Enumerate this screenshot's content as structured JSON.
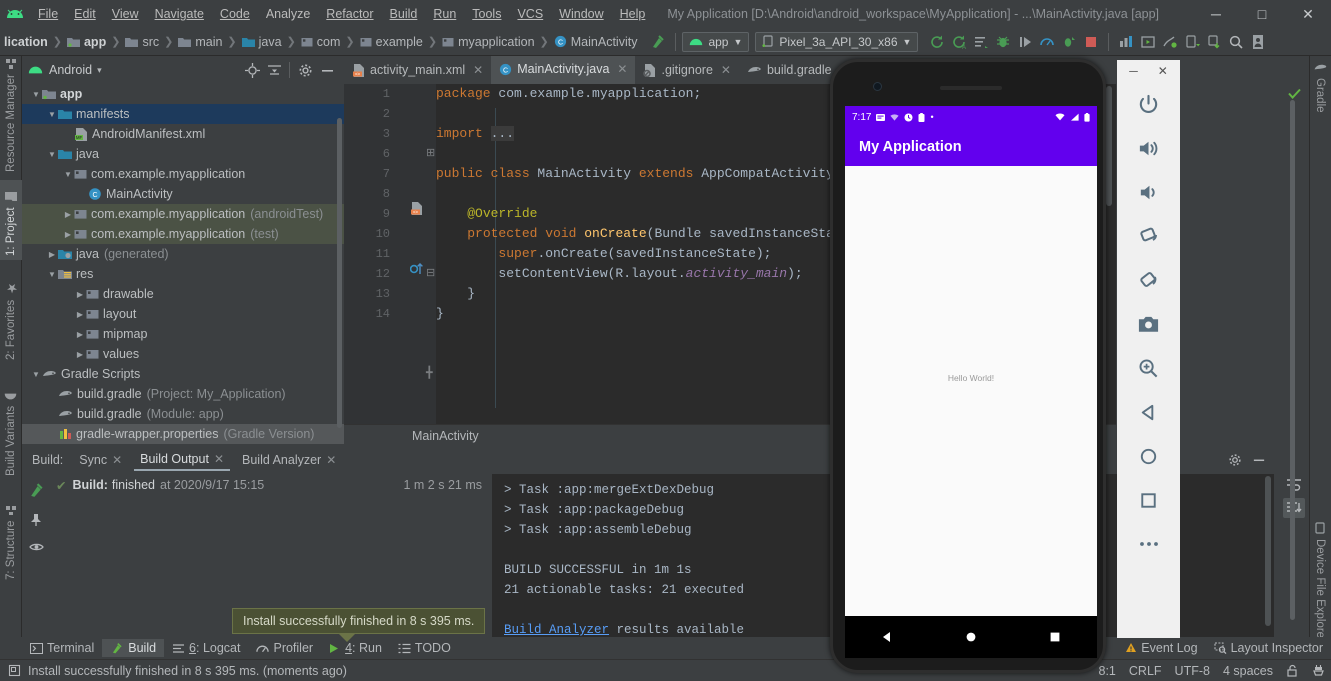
{
  "window": {
    "title": "My Application [D:\\Android\\android_workspace\\MyApplication] - ...\\MainActivity.java [app]",
    "minimize": "─",
    "maximize": "□",
    "close": "✕"
  },
  "menubar": {
    "items": [
      {
        "label": "File"
      },
      {
        "label": "Edit"
      },
      {
        "label": "View"
      },
      {
        "label": "Navigate"
      },
      {
        "label": "Code"
      },
      {
        "label": "Analyze"
      },
      {
        "label": "Refactor"
      },
      {
        "label": "Build"
      },
      {
        "label": "Run"
      },
      {
        "label": "Tools"
      },
      {
        "label": "VCS"
      },
      {
        "label": "Window"
      },
      {
        "label": "Help"
      }
    ]
  },
  "toolbar": {
    "breadcrumb": [
      {
        "label": "lication",
        "icon": "project-icon"
      },
      {
        "label": "app",
        "icon": "module-icon"
      },
      {
        "label": "src",
        "icon": "folder-icon"
      },
      {
        "label": "main",
        "icon": "folder-icon"
      },
      {
        "label": "java",
        "icon": "source-folder-icon"
      },
      {
        "label": "com",
        "icon": "package-icon"
      },
      {
        "label": "example",
        "icon": "package-icon"
      },
      {
        "label": "myapplication",
        "icon": "package-icon"
      },
      {
        "label": "MainActivity",
        "icon": "class-icon"
      }
    ],
    "run_config": "app",
    "device": "Pixel_3a_API_30_x86",
    "icons": [
      "sync-project-icon",
      "avd-manager-icon",
      "layout-inspector-icon",
      "debug-icon",
      "run-step-icon",
      "profiler-icon",
      "run-attach-icon",
      "stop-icon",
      "sdk-manager-icon",
      "avd-icon",
      "device-manager-icon",
      "device-monitor-icon",
      "sync-gradle-icon",
      "search-icon",
      "user-icon"
    ]
  },
  "left_rail": {
    "items": [
      {
        "label": "Resource Manager",
        "selected": false
      },
      {
        "label": "1: Project",
        "selected": true
      },
      {
        "label": "2: Favorites",
        "selected": false
      },
      {
        "label": "Build Variants",
        "selected": false
      },
      {
        "label": "7: Structure",
        "selected": false
      }
    ]
  },
  "right_rail": {
    "items": [
      {
        "label": "Gradle"
      },
      {
        "label": "Device File Explorer"
      }
    ]
  },
  "project_panel": {
    "title": "Android",
    "dropdown": "▾",
    "header_icons": [
      "locate-icon",
      "collapse-all-icon",
      "gear-icon",
      "hide-icon"
    ],
    "tree": [
      {
        "indent": 0,
        "arrow": "▼",
        "icon": "module-icon",
        "label": "app",
        "dim": "",
        "state": "bold"
      },
      {
        "indent": 1,
        "arrow": "▼",
        "icon": "folder-blue-icon",
        "label": "manifests",
        "dim": "",
        "state": "selected"
      },
      {
        "indent": 2,
        "arrow": "",
        "icon": "manifest-file-icon",
        "label": "AndroidManifest.xml",
        "dim": "",
        "state": ""
      },
      {
        "indent": 1,
        "arrow": "▼",
        "icon": "folder-blue-icon",
        "label": "java",
        "dim": "",
        "state": ""
      },
      {
        "indent": 2,
        "arrow": "▼",
        "icon": "package-icon",
        "label": "com.example.myapplication",
        "dim": "",
        "state": ""
      },
      {
        "indent": 3,
        "arrow": "",
        "icon": "class-icon",
        "label": "MainActivity",
        "dim": "",
        "state": ""
      },
      {
        "indent": 2,
        "arrow": "▶",
        "icon": "package-icon",
        "label": "com.example.myapplication",
        "dim": "(androidTest)",
        "state": "testscope"
      },
      {
        "indent": 2,
        "arrow": "▶",
        "icon": "package-icon",
        "label": "com.example.myapplication",
        "dim": "(test)",
        "state": "testscope"
      },
      {
        "indent": 1,
        "arrow": "▶",
        "icon": "generated-folder-icon",
        "label": "java",
        "dim": "(generated)",
        "state": ""
      },
      {
        "indent": 1,
        "arrow": "▼",
        "icon": "res-folder-icon",
        "label": "res",
        "dim": "",
        "state": ""
      },
      {
        "indent": 2,
        "arrow": "▶",
        "icon": "package-icon",
        "label": "drawable",
        "dim": "",
        "state": ""
      },
      {
        "indent": 2,
        "arrow": "▶",
        "icon": "package-icon",
        "label": "layout",
        "dim": "",
        "state": ""
      },
      {
        "indent": 2,
        "arrow": "▶",
        "icon": "package-icon",
        "label": "mipmap",
        "dim": "",
        "state": ""
      },
      {
        "indent": 2,
        "arrow": "▶",
        "icon": "package-icon",
        "label": "values",
        "dim": "",
        "state": ""
      },
      {
        "indent": 0,
        "arrow": "▼",
        "icon": "gradle-icon",
        "label": "Gradle Scripts",
        "dim": "",
        "state": ""
      },
      {
        "indent": 1,
        "arrow": "",
        "icon": "gradle-icon",
        "label": "build.gradle",
        "dim": "(Project: My_Application)",
        "state": ""
      },
      {
        "indent": 1,
        "arrow": "",
        "icon": "gradle-icon",
        "label": "build.gradle",
        "dim": "(Module: app)",
        "state": ""
      },
      {
        "indent": 1,
        "arrow": "",
        "icon": "properties-icon",
        "label": "gradle-wrapper.properties",
        "dim": "(Gradle Version)",
        "state": "gw"
      }
    ]
  },
  "editor": {
    "tabs": [
      {
        "label": "activity_main.xml",
        "icon": "layout-xml-icon",
        "active": false,
        "close": "✕"
      },
      {
        "label": "MainActivity.java",
        "icon": "class-icon",
        "active": true,
        "close": "✕"
      },
      {
        "label": ".gitignore",
        "icon": "gitignore-icon",
        "active": false,
        "close": "✕"
      },
      {
        "label": "build.gradle",
        "icon": "gradle-icon",
        "active": false,
        "close": ""
      }
    ],
    "line_numbers": [
      "1",
      "2",
      "3",
      "6",
      "7",
      "8",
      "9",
      "10",
      "11",
      "12",
      "13",
      "14"
    ],
    "lines": [
      "package com.example.myapplication;",
      "",
      "import ...",
      "",
      "public class MainActivity extends AppCompatActivity {",
      "",
      "    @Override",
      "    protected void onCreate(Bundle savedInstanceState) {",
      "        super.onCreate(savedInstanceState);",
      "        setContentView(R.layout.activity_main);",
      "    }",
      "}"
    ],
    "breadcrumb_bottom": "MainActivity"
  },
  "build_panel": {
    "label": "Build:",
    "tabs": [
      {
        "label": "Sync",
        "active": false,
        "close": "✕"
      },
      {
        "label": "Build Output",
        "active": true,
        "close": "✕"
      },
      {
        "label": "Build Analyzer",
        "active": false,
        "close": "✕"
      }
    ],
    "toolbar_icons": [
      "run-icon",
      "pin-icon",
      "eye-icon"
    ],
    "tree": {
      "status_prefix": "Build:",
      "status": "finished",
      "status_at": "at 2020/9/17 15:15",
      "duration": "1 m 2 s 21 ms",
      "check": "✔"
    },
    "output": [
      {
        "text": "> Task :app:mergeExtDexDebug",
        "link": false
      },
      {
        "text": "> Task :app:packageDebug",
        "link": false
      },
      {
        "text": "> Task :app:assembleDebug",
        "link": false
      },
      {
        "text": "",
        "link": false
      },
      {
        "text": "BUILD SUCCESSFUL in 1m 1s",
        "link": false
      },
      {
        "text": "21 actionable tasks: 21 executed",
        "link": false
      },
      {
        "text": "",
        "link": false
      },
      {
        "text": "Build Analyzer results available",
        "link": true,
        "link_text": "Build Analyzer",
        "tail": " results available"
      }
    ],
    "right_icons": [
      "gear-icon",
      "hide-icon",
      "wrap-icon",
      "scroll-end-icon"
    ]
  },
  "tooltip": {
    "text": "Install successfully finished in 8 s 395 ms."
  },
  "bottom_tabs": {
    "items": [
      {
        "label": "Terminal",
        "icon": "terminal-icon",
        "active": false
      },
      {
        "label": "Build",
        "icon": "build-hammer-icon",
        "active": true
      },
      {
        "label": "6: Logcat",
        "icon": "logcat-icon",
        "active": false
      },
      {
        "label": "Profiler",
        "icon": "profiler-icon",
        "active": false
      },
      {
        "label": "4: Run",
        "icon": "run-icon",
        "active": false
      },
      {
        "label": "TODO",
        "icon": "todo-icon",
        "active": false
      }
    ],
    "right_items": [
      {
        "label": "Event Log",
        "icon": "event-log-icon"
      },
      {
        "label": "Layout Inspector",
        "icon": "layout-inspector-icon"
      }
    ]
  },
  "statusbar": {
    "message": "Install successfully finished in 8 s 395 ms. (moments ago)",
    "icon": "notification-icon",
    "caret": "8:1",
    "line_ending": "CRLF",
    "encoding": "UTF-8",
    "indent": "4 spaces",
    "lock_icon": "unlock-icon",
    "inspect_icon": "inspection-icon"
  },
  "emulator": {
    "window_controls": {
      "minimize": "─",
      "close": "✕"
    },
    "device_status": {
      "time": "7:17",
      "icons": [
        "message-icon",
        "wifi-status-icon",
        "clock-icon",
        "battery-status-icon",
        "dot-icon"
      ],
      "right_icons": [
        "wifi-icon",
        "signal-icon",
        "battery-icon"
      ]
    },
    "app": {
      "title": "My Application",
      "body_text": "Hello World!",
      "primary_color": "#6200ee",
      "background_color": "#fafafa"
    },
    "nav_buttons": [
      "back-nav-icon",
      "home-nav-icon",
      "recents-nav-icon"
    ],
    "sidebar_buttons": [
      "power-icon",
      "volume-up-icon",
      "volume-down-icon",
      "rotate-left-icon",
      "rotate-right-icon",
      "screenshot-icon",
      "zoom-icon",
      "back-icon",
      "home-icon",
      "overview-icon",
      "more-icon"
    ]
  }
}
